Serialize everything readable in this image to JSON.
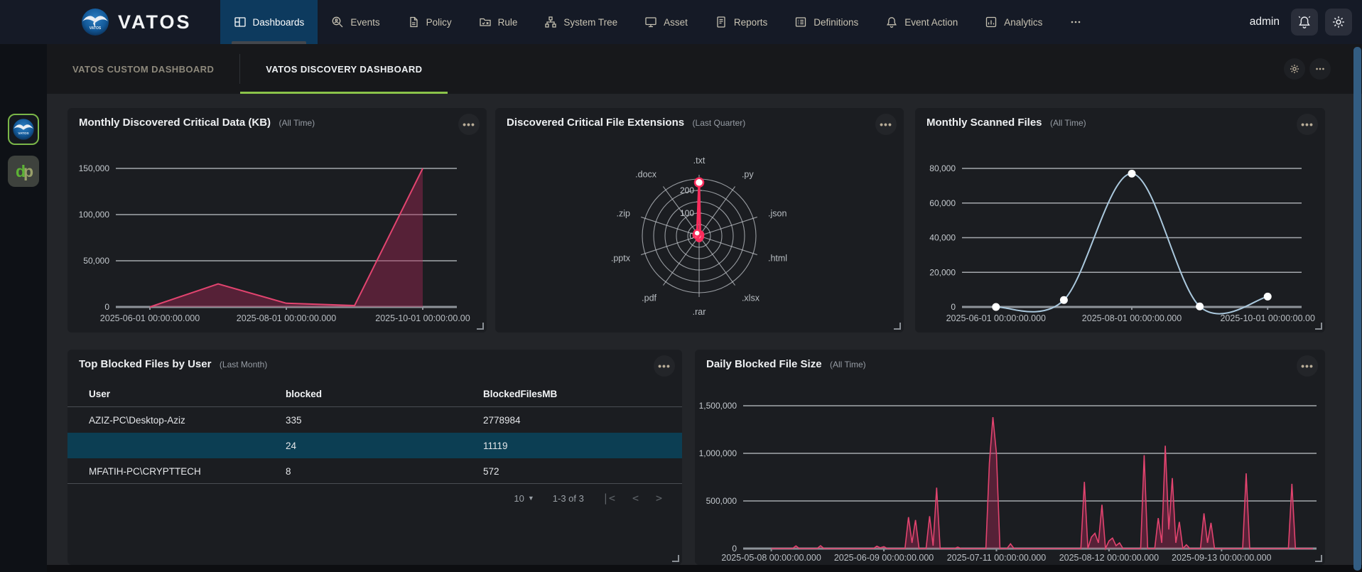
{
  "navbar": {
    "brand": "VATOS",
    "user": "admin",
    "items": [
      {
        "label": "Dashboards",
        "icon": "dashboards",
        "active": true
      },
      {
        "label": "Events",
        "icon": "events",
        "active": false
      },
      {
        "label": "Policy",
        "icon": "policy",
        "active": false
      },
      {
        "label": "Rule",
        "icon": "rule",
        "active": false
      },
      {
        "label": "System Tree",
        "icon": "tree",
        "active": false
      },
      {
        "label": "Asset",
        "icon": "asset",
        "active": false
      },
      {
        "label": "Reports",
        "icon": "reports",
        "active": false
      },
      {
        "label": "Definitions",
        "icon": "definitions",
        "active": false
      },
      {
        "label": "Event Action",
        "icon": "bell",
        "active": false
      },
      {
        "label": "Analytics",
        "icon": "analytics",
        "active": false
      },
      {
        "label": "",
        "icon": "more",
        "active": false
      }
    ]
  },
  "dashboard_tabs": [
    {
      "label": "VATOS CUSTOM DASHBOARD",
      "active": false
    },
    {
      "label": "VATOS DISCOVERY DASHBOARD",
      "active": true
    }
  ],
  "sidebar": {
    "apps": [
      {
        "name": "vatos-app"
      },
      {
        "name": "dp-app",
        "text_d": "d",
        "text_p": "p"
      }
    ]
  },
  "chart_data": [
    {
      "type": "area",
      "title": "Monthly Discovered Critical Data (KB)",
      "period": "(All Time)",
      "x": [
        "2025-06-01",
        "2025-07-01",
        "2025-08-01",
        "2025-09-01",
        "2025-10-01"
      ],
      "values": [
        0,
        25000,
        4000,
        1500,
        150000
      ],
      "ylim": [
        0,
        150000
      ],
      "yticks": [
        0,
        50000,
        100000,
        150000
      ],
      "xtick_labels": [
        "2025-06-01 00:00:00.000",
        "2025-08-01 00:00:00.000",
        "2025-10-01 00:00:00.00"
      ],
      "xtick_idx": [
        0,
        2,
        4
      ],
      "grid": true,
      "line_color": "#e2446f",
      "fill_color": "rgba(170,40,85,0.42)"
    },
    {
      "type": "radar",
      "title": "Discovered Critical File Extensions",
      "period": "(Last Quarter)",
      "axes": [
        ".txt",
        ".py",
        ".json",
        ".html",
        ".xlsx",
        ".rar",
        ".pdf",
        ".pptx",
        ".zip",
        ".docx"
      ],
      "values": [
        235,
        8,
        5,
        3,
        6,
        10,
        4,
        3,
        12,
        15
      ],
      "rlim": [
        0,
        250
      ],
      "rings": [
        50,
        100,
        150,
        200,
        250
      ],
      "ring_labels": [
        0,
        100,
        200
      ],
      "line_color": "#fb2c5c",
      "fill_color": "rgba(251,44,92,0.18)"
    },
    {
      "type": "line",
      "title": "Monthly Scanned Files",
      "period": "(All Time)",
      "x": [
        "2025-06-01",
        "2025-07-01",
        "2025-08-01",
        "2025-09-01",
        "2025-10-01"
      ],
      "values": [
        0,
        4000,
        77000,
        300,
        6000
      ],
      "ylim": [
        0,
        80000
      ],
      "yticks": [
        0,
        20000,
        40000,
        60000,
        80000
      ],
      "xtick_labels": [
        "2025-06-01 00:00:00.000",
        "2025-08-01 00:00:00.000",
        "2025-10-01 00:00:00.00"
      ],
      "xtick_idx": [
        0,
        2,
        4
      ],
      "grid": true,
      "line_color": "#aac8dd",
      "dot_color": "#ffffff"
    },
    {
      "type": "table",
      "title": "Top Blocked Files by User",
      "period": "(Last Month)",
      "columns": [
        "User",
        "blocked",
        "BlockedFilesMB"
      ],
      "rows": [
        [
          "AZIZ-PC\\Desktop-Aziz",
          "335",
          "2778984"
        ],
        [
          "",
          "24",
          "11119"
        ],
        [
          "MFATIH-PC\\CRYPTTECH",
          "8",
          "572"
        ]
      ],
      "highlight_row_index": 1,
      "pagination": {
        "page_size": "10",
        "range": "1-3 of 3"
      }
    },
    {
      "type": "spike_area",
      "title": "Daily Blocked File Size",
      "period": "(All Time)",
      "x0_date": "2025-05-08",
      "points": [
        [
          0,
          0
        ],
        [
          6,
          0
        ],
        [
          7,
          28000
        ],
        [
          8,
          0
        ],
        [
          13,
          0
        ],
        [
          14,
          30000
        ],
        [
          15,
          0
        ],
        [
          29,
          0
        ],
        [
          30,
          25000
        ],
        [
          31,
          8000
        ],
        [
          32,
          20000
        ],
        [
          33,
          0
        ],
        [
          38,
          0
        ],
        [
          39,
          330000
        ],
        [
          40,
          60000
        ],
        [
          41,
          300000
        ],
        [
          42,
          0
        ],
        [
          44,
          0
        ],
        [
          45,
          340000
        ],
        [
          46,
          30000
        ],
        [
          47,
          640000
        ],
        [
          48,
          0
        ],
        [
          52,
          0
        ],
        [
          53,
          15000
        ],
        [
          54,
          0
        ],
        [
          61,
          0
        ],
        [
          62,
          900000
        ],
        [
          63,
          1380000
        ],
        [
          64,
          1000000
        ],
        [
          65,
          0
        ],
        [
          67,
          0
        ],
        [
          68,
          50000
        ],
        [
          69,
          0
        ],
        [
          88,
          0
        ],
        [
          89,
          700000
        ],
        [
          90,
          0
        ],
        [
          91,
          120000
        ],
        [
          92,
          160000
        ],
        [
          93,
          60000
        ],
        [
          94,
          460000
        ],
        [
          95,
          0
        ],
        [
          96,
          80000
        ],
        [
          97,
          110000
        ],
        [
          98,
          30000
        ],
        [
          99,
          60000
        ],
        [
          100,
          0
        ],
        [
          105,
          0
        ],
        [
          106,
          980000
        ],
        [
          107,
          0
        ],
        [
          109,
          0
        ],
        [
          110,
          320000
        ],
        [
          111,
          60000
        ],
        [
          112,
          1080000
        ],
        [
          113,
          200000
        ],
        [
          114,
          740000
        ],
        [
          115,
          60000
        ],
        [
          116,
          280000
        ],
        [
          117,
          0
        ],
        [
          118,
          40000
        ],
        [
          119,
          0
        ],
        [
          122,
          0
        ],
        [
          123,
          370000
        ],
        [
          124,
          60000
        ],
        [
          125,
          270000
        ],
        [
          126,
          0
        ],
        [
          134,
          0
        ],
        [
          135,
          790000
        ],
        [
          136,
          0
        ],
        [
          147,
          0
        ],
        [
          148,
          680000
        ],
        [
          149,
          0
        ],
        [
          154,
          0
        ]
      ],
      "ylim": [
        0,
        1500000
      ],
      "yticks": [
        0,
        500000,
        1000000,
        1500000
      ],
      "xticks": [
        {
          "day": 0,
          "label": "2025-05-08 00:00:00.000"
        },
        {
          "day": 32,
          "label": "2025-06-09 00:00:00.000"
        },
        {
          "day": 64,
          "label": "2025-07-11 00:00:00.000"
        },
        {
          "day": 96,
          "label": "2025-08-12 00:00:00.000"
        },
        {
          "day": 128,
          "label": "2025-09-13 00:00:00.000"
        }
      ],
      "grid": true,
      "line_color": "#e2446f",
      "fill_color": "rgba(170,40,85,0.42)"
    }
  ]
}
